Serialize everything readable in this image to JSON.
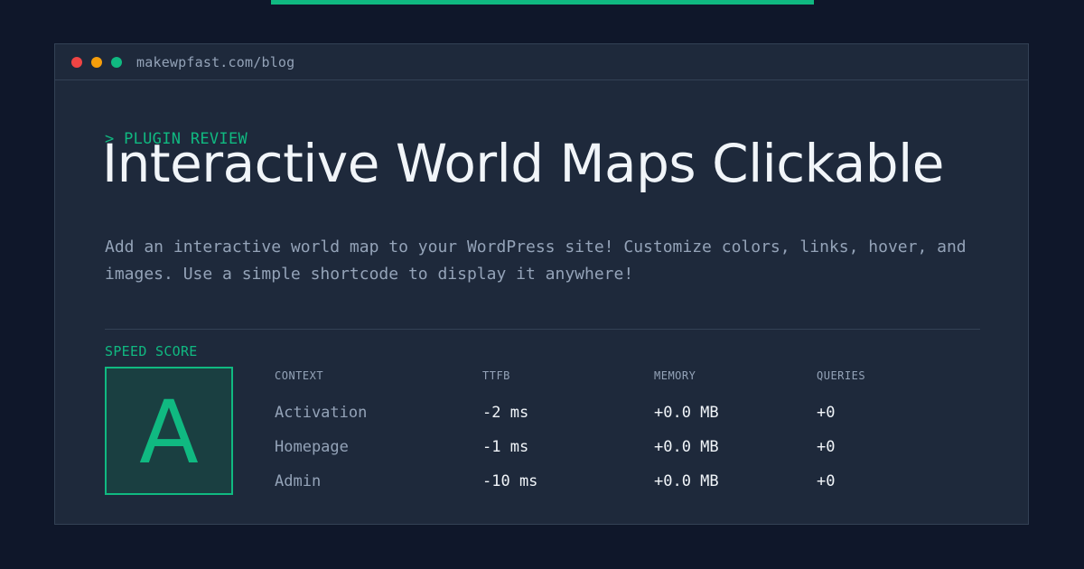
{
  "colors": {
    "accent": "#10b981",
    "background": "#0f172a",
    "window": "#1e293b",
    "dot_red": "#ef4444",
    "dot_amber": "#f59e0b",
    "dot_green": "#10b981"
  },
  "window": {
    "url": "makewpfast.com/blog"
  },
  "hero": {
    "kicker": "> PLUGIN REVIEW",
    "title": "Interactive World Maps Clickable",
    "description": "Add an interactive world map to your WordPress site! Customize colors, links, hover, and images. Use a simple shortcode to display it anywhere!"
  },
  "score": {
    "label": "SPEED SCORE",
    "grade": "A"
  },
  "metrics": {
    "headers": [
      "CONTEXT",
      "TTFB",
      "MEMORY",
      "QUERIES"
    ],
    "rows": [
      {
        "context": "Activation",
        "ttfb": "-2 ms",
        "memory": "+0.0 MB",
        "queries": "+0"
      },
      {
        "context": "Homepage",
        "ttfb": "-1 ms",
        "memory": "+0.0 MB",
        "queries": "+0"
      },
      {
        "context": "Admin",
        "ttfb": "-10 ms",
        "memory": "+0.0 MB",
        "queries": "+0"
      }
    ]
  }
}
